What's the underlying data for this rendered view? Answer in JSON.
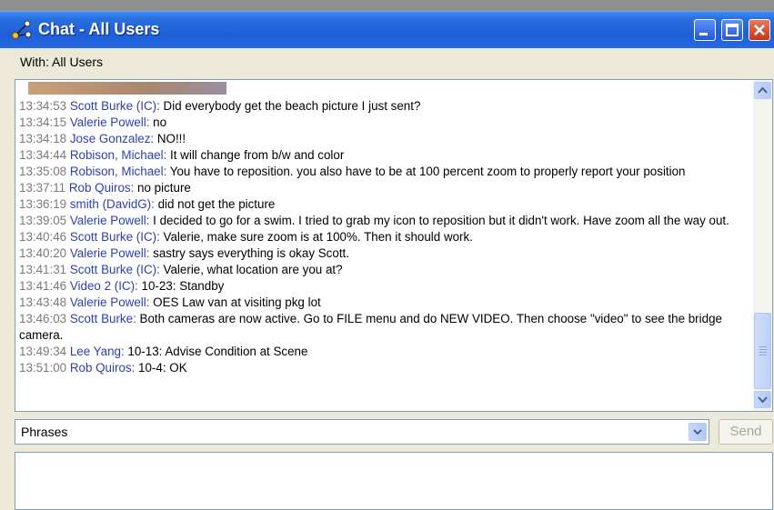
{
  "window": {
    "title": "Chat - All Users"
  },
  "with_label": "With: All Users",
  "messages": [
    {
      "time": "13:34:53",
      "user": "Scott Burke (IC):",
      "text": " Did everybody get the beach picture I just sent?"
    },
    {
      "time": "13:34:15",
      "user": "Valerie Powell:",
      "text": " no"
    },
    {
      "time": "13:34:18",
      "user": "Jose Gonzalez:",
      "text": " NO!!!"
    },
    {
      "time": "13:34:44",
      "user": "Robison, Michael:",
      "text": " It will change from b/w and color"
    },
    {
      "time": "13:35:08",
      "user": "Robison, Michael:",
      "text": " You have to reposition.  you also have to be at 100 percent zoom to properly report your position"
    },
    {
      "time": "13:37:11",
      "user": "Rob Quiros:",
      "text": " no picture"
    },
    {
      "time": "13:36:19",
      "user": "smith (DavidG):",
      "text": " did not get the picture"
    },
    {
      "time": "13:39:05",
      "user": "Valerie Powell:",
      "text": " I decided to go for a swim. I tried to grab my icon to reposition but it didn't work. Have zoom all the way out."
    },
    {
      "time": "13:40:46",
      "user": "Scott Burke (IC):",
      "text": " Valerie, make sure zoom is at 100%. Then it should work."
    },
    {
      "time": "13:40:20",
      "user": "Valerie Powell:",
      "text": " sastry says everything is okay Scott."
    },
    {
      "time": "13:41:31",
      "user": "Scott Burke (IC):",
      "text": " Valerie, what location are you at?"
    },
    {
      "time": "13:41:46",
      "user": "Video 2 (IC):",
      "text": " 10-23: Standby"
    },
    {
      "time": "13:43:48",
      "user": "Valerie Powell:",
      "text": " OES Law van at visiting pkg lot"
    },
    {
      "time": "13:46:03",
      "user": "Scott Burke:",
      "text": " Both cameras are now active. Go to FILE menu and do NEW VIDEO. Then choose \"video\" to see the bridge camera."
    },
    {
      "time": "13:49:34",
      "user": "Lee Yang:",
      "text": " 10-13: Advise Condition at Scene"
    },
    {
      "time": "13:51:00",
      "user": "Rob Quiros:",
      "text": " 10-4: OK"
    }
  ],
  "phrases": {
    "selected": "Phrases"
  },
  "send_label": "Send",
  "colors": {
    "titlebar": "#2568e3",
    "username": "#2b3fb0",
    "timestamp": "#7a7a7a",
    "chrome": "#ece9d8"
  },
  "icons": [
    "app-icon",
    "minimize-icon",
    "maximize-icon",
    "close-icon",
    "scroll-up-icon",
    "scroll-down-icon",
    "dropdown-arrow-icon"
  ]
}
